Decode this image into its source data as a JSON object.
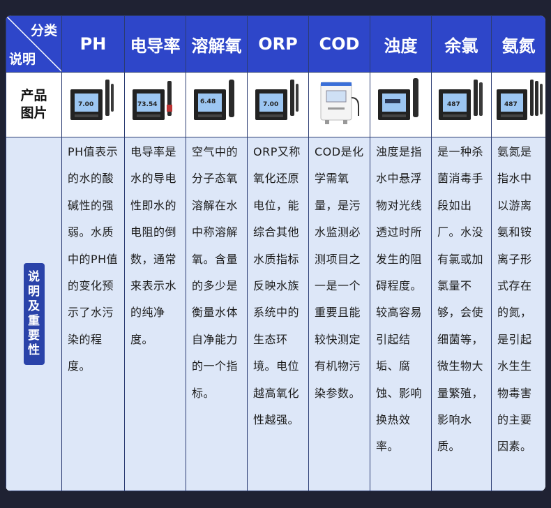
{
  "header": {
    "corner_top": "分类",
    "corner_bottom": "说明",
    "columns": [
      "PH",
      "电导率",
      "溶解氧",
      "ORP",
      "COD",
      "浊度",
      "余氯",
      "氨氮"
    ]
  },
  "image_row": {
    "label_line1": "产品",
    "label_line2": "图片",
    "device_readings": [
      "7.00",
      "73.54",
      "6.48",
      "7.00",
      "",
      "",
      "487",
      "487"
    ]
  },
  "description_row": {
    "side_label": "说明及重要性",
    "cells": [
      "PH值表示的水的酸碱性的强弱。水质中的PH值的变化预示了水污染的程度。",
      "电导率是水的导电性即水的电阻的倒数，通常来表示水的纯净度。",
      "空气中的分子态氧溶解在水中称溶解氧。含量的多少是衡量水体自净能力的一个指标。",
      "ORP又称氧化还原电位，能综合其他水质指标反映水族系统中的生态环境。电位越高氧化性越强。",
      "COD是化学需氧量，是污水监测必测项目之一是一个重要且能较快测定有机物污染参数。",
      "浊度是指水中悬浮物对光线透过时所发生的阻碍程度。较高容易引起结垢、腐蚀、影响换热效率。",
      "是一种杀菌消毒手段如出厂。水没有氯或加氯量不够，会使细菌等，微生物大量繁殖，影响水质。",
      "氨氮是指水中以游离氨和铵离子形式存在的氮，是引起水生生物毒害的主要因素。"
    ]
  },
  "colors": {
    "page_background": "#1f2233",
    "header_blue": "#2e46c9",
    "description_background": "#dde7f8",
    "side_badge": "#2a43a9"
  },
  "icons": [
    "ph-meter-icon",
    "conductivity-meter-icon",
    "dissolved-oxygen-meter-icon",
    "orp-meter-icon",
    "cod-analyzer-icon",
    "turbidity-meter-icon",
    "residual-chlorine-meter-icon",
    "ammonia-nitrogen-meter-icon"
  ]
}
